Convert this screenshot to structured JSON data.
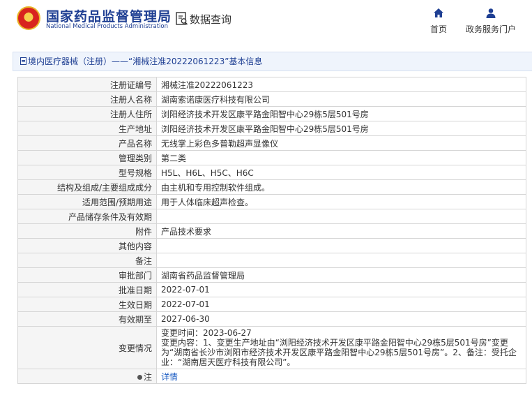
{
  "header": {
    "logo_cn": "国家药品监督管理局",
    "logo_en": "National Medical Products Administration",
    "data_query": "数据查询",
    "nav_home": "首页",
    "nav_gov": "政务服务门户"
  },
  "title": "境内医疗器械（注册）——“湘械注准20222061223”基本信息",
  "fields": [
    {
      "label": "注册证编号",
      "value": "湘械注准20222061223"
    },
    {
      "label": "注册人名称",
      "value": "湖南索诺康医疗科技有限公司"
    },
    {
      "label": "注册人住所",
      "value": "浏阳经济技术开发区康平路金阳智中心29栋5层501号房"
    },
    {
      "label": "生产地址",
      "value": "浏阳经济技术开发区康平路金阳智中心29栋5层501号房"
    },
    {
      "label": "产品名称",
      "value": "无线掌上彩色多普勒超声显像仪"
    },
    {
      "label": "管理类别",
      "value": "第二类"
    },
    {
      "label": "型号规格",
      "value": "H5L、H6L、H5C、H6C"
    },
    {
      "label": "结构及组成/主要组成成分",
      "value": "由主机和专用控制软件组成。"
    },
    {
      "label": "适用范围/预期用途",
      "value": "用于人体临床超声检查。"
    },
    {
      "label": "产品储存条件及有效期",
      "value": ""
    },
    {
      "label": "附件",
      "value": "产品技术要求"
    },
    {
      "label": "其他内容",
      "value": ""
    },
    {
      "label": "备注",
      "value": ""
    },
    {
      "label": "审批部门",
      "value": "湖南省药品监督管理局"
    },
    {
      "label": "批准日期",
      "value": "2022-07-01"
    },
    {
      "label": "生效日期",
      "value": "2022-07-01"
    },
    {
      "label": "有效期至",
      "value": "2027-06-30"
    }
  ],
  "change": {
    "label": "变更情况",
    "line1": "变更时间：2023-06-27",
    "line2": "变更内容：1、变更生产地址由“浏阳经济技术开发区康平路金阳智中心29栋5层501号房”变更为“湖南省长沙市浏阳市经济技术开发区康平路金阳智中心29栋5层501号房”。2、备注：受托企业：“湖南居天医疗科技有限公司”。"
  },
  "note": {
    "label": "注",
    "link": "详情"
  }
}
